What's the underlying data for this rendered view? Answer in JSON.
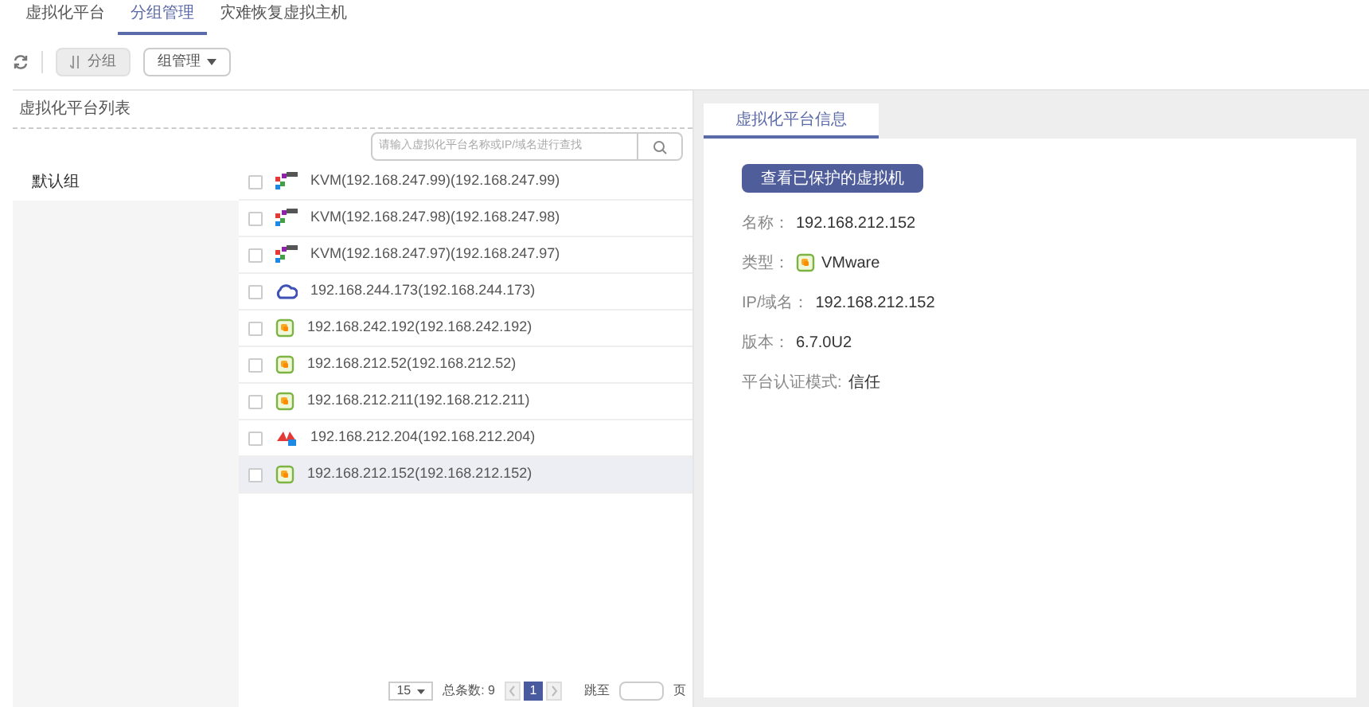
{
  "tabs": [
    {
      "label": "虚拟化平台",
      "selected": false
    },
    {
      "label": "分组管理",
      "selected": true
    },
    {
      "label": "灾难恢复虚拟主机",
      "selected": false
    }
  ],
  "toolbar": {
    "group_button": {
      "label": "分组",
      "disabled": true
    },
    "manage_button": {
      "label": "组管理"
    }
  },
  "list_panel": {
    "title": "虚拟化平台列表",
    "search": {
      "placeholder": "请输入虚拟化平台名称或IP/域名进行查找"
    },
    "groups": [
      {
        "label": "默认组",
        "selected": true
      }
    ],
    "platforms": [
      {
        "kind": "kvm",
        "label": "KVM(192.168.247.99)(192.168.247.99)",
        "checked": false,
        "selected": false
      },
      {
        "kind": "kvm",
        "label": "KVM(192.168.247.98)(192.168.247.98)",
        "checked": false,
        "selected": false
      },
      {
        "kind": "kvm",
        "label": "KVM(192.168.247.97)(192.168.247.97)",
        "checked": false,
        "selected": false
      },
      {
        "kind": "cloud",
        "label": "192.168.244.173(192.168.244.173)",
        "checked": false,
        "selected": false
      },
      {
        "kind": "vmware",
        "label": "192.168.242.192(192.168.242.192)",
        "checked": false,
        "selected": false
      },
      {
        "kind": "vmware",
        "label": "192.168.212.52(192.168.212.52)",
        "checked": false,
        "selected": false
      },
      {
        "kind": "vmware",
        "label": "192.168.212.211(192.168.212.211)",
        "checked": false,
        "selected": false
      },
      {
        "kind": "huawei",
        "label": "192.168.212.204(192.168.212.204)",
        "checked": false,
        "selected": false
      },
      {
        "kind": "vmware",
        "label": "192.168.212.152(192.168.212.152)",
        "checked": false,
        "selected": true
      }
    ],
    "pagination": {
      "page_size": "15",
      "total": "总条数: 9",
      "pages": [
        {
          "label": "1",
          "selected": true
        }
      ],
      "jump_label": "跳至",
      "page_suffix": "页"
    }
  },
  "info_panel": {
    "tab": "虚拟化平台信息",
    "button": "查看已保护的虚拟机",
    "fields": [
      {
        "kind": "text",
        "label": "名称：",
        "value": "192.168.212.152"
      },
      {
        "kind": "vmware",
        "label": "类型：",
        "value": "VMware"
      },
      {
        "kind": "text",
        "label": "IP/域名：",
        "value": "192.168.212.152"
      },
      {
        "kind": "text",
        "label": "版本：",
        "value": "6.7.0U2"
      },
      {
        "kind": "text",
        "label": "平台认证模式:",
        "value": "信任"
      }
    ]
  }
}
